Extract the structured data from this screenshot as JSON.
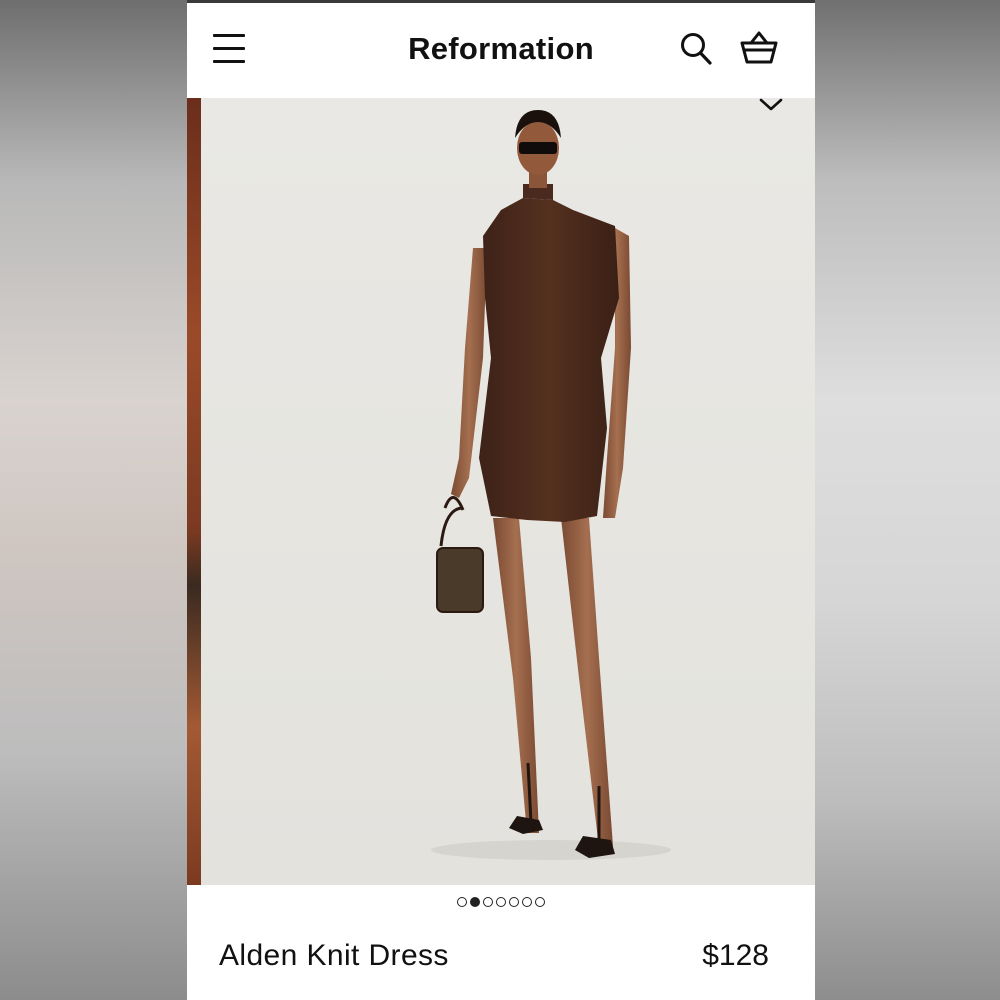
{
  "header": {
    "brand": "Reformation",
    "menu_icon": "hamburger-menu-icon",
    "search_icon": "search-icon",
    "bag_icon": "shopping-basket-icon"
  },
  "gallery": {
    "image_description_icon": "product-photo",
    "total_images": 7,
    "active_index": 1,
    "chevron_icon": "chevron-down-icon"
  },
  "product": {
    "name": "Alden Knit Dress",
    "price": "$128"
  },
  "colors": {
    "dress": "#4a2a1f",
    "background": "#e7e6e2"
  }
}
